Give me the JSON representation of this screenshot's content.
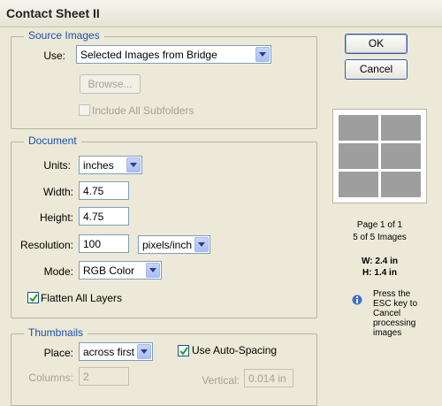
{
  "window": {
    "title": "Contact Sheet II"
  },
  "buttons": {
    "ok": "OK",
    "cancel": "Cancel"
  },
  "source_images": {
    "group_label": "Source Images",
    "use_label": "Use:",
    "use_value": "Selected Images from Bridge",
    "browse_label": "Browse...",
    "include_subfolders_label": "Include All Subfolders",
    "include_subfolders_checked": false
  },
  "document": {
    "group_label": "Document",
    "units_label": "Units:",
    "units_value": "inches",
    "width_label": "Width:",
    "width_value": "4.75",
    "height_label": "Height:",
    "height_value": "4.75",
    "resolution_label": "Resolution:",
    "resolution_value": "100",
    "resolution_unit": "pixels/inch",
    "mode_label": "Mode:",
    "mode_value": "RGB Color",
    "flatten_label": "Flatten All Layers",
    "flatten_checked": true
  },
  "thumbnails": {
    "group_label": "Thumbnails",
    "place_label": "Place:",
    "place_value": "across first",
    "auto_spacing_label": "Use Auto-Spacing",
    "auto_spacing_checked": true,
    "columns_label": "Columns:",
    "columns_value": "2",
    "vertical_label": "Vertical:",
    "vertical_value": "0.014 in"
  },
  "preview": {
    "page_info": "Page 1 of 1",
    "images_info": "5 of 5 Images",
    "width_info": "W: 2.4 in",
    "height_info": "H: 1.4 in",
    "hint_lines": [
      "Press the",
      "ESC key to",
      "Cancel",
      "processing",
      "images"
    ]
  }
}
